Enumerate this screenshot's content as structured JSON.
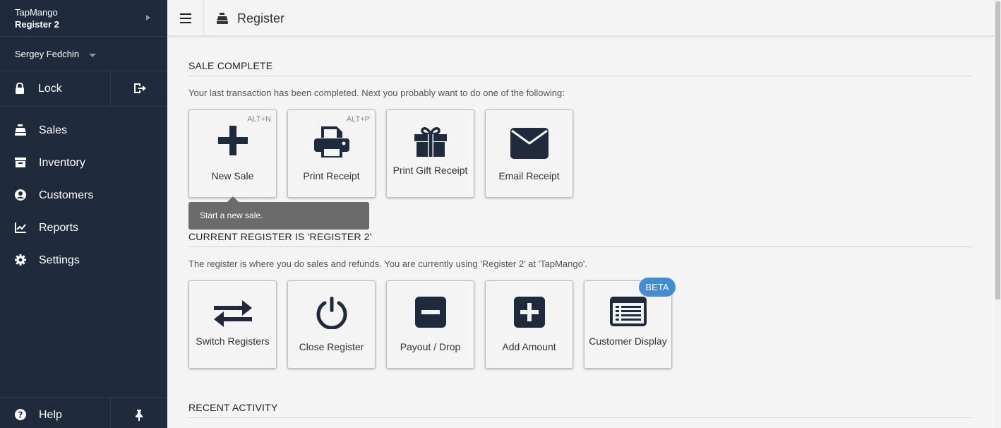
{
  "sidebar": {
    "store_name": "TapMango",
    "register_name": "Register 2",
    "user_name": "Sergey Fedchin",
    "lock_label": "Lock",
    "nav": [
      {
        "label": "Sales",
        "icon": "register-icon"
      },
      {
        "label": "Inventory",
        "icon": "inventory-icon"
      },
      {
        "label": "Customers",
        "icon": "user-circle-icon"
      },
      {
        "label": "Reports",
        "icon": "chart-line-icon"
      },
      {
        "label": "Settings",
        "icon": "gear-icon"
      }
    ],
    "help_label": "Help"
  },
  "topbar": {
    "title": "Register"
  },
  "sale_complete": {
    "title": "SALE COMPLETE",
    "description": "Your last transaction has been completed. Next you probably want to do one of the following:",
    "tiles": [
      {
        "label": "New Sale",
        "shortcut": "ALT+N",
        "icon": "plus-icon"
      },
      {
        "label": "Print Receipt",
        "shortcut": "ALT+P",
        "icon": "printer-icon"
      },
      {
        "label": "Print Gift Receipt",
        "icon": "gift-icon"
      },
      {
        "label": "Email Receipt",
        "icon": "envelope-icon"
      }
    ],
    "tooltip": "Start a new sale."
  },
  "current_register": {
    "title": "CURRENT REGISTER IS 'REGISTER 2'",
    "description": "The register is where you do sales and refunds. You are currently using 'Register 2'  at 'TapMango'.",
    "tiles": [
      {
        "label": "Switch Registers",
        "icon": "exchange-icon"
      },
      {
        "label": "Close Register",
        "icon": "power-icon"
      },
      {
        "label": "Payout / Drop",
        "icon": "minus-square-icon"
      },
      {
        "label": "Add Amount",
        "icon": "plus-square-icon"
      },
      {
        "label": "Customer Display",
        "icon": "list-display-icon",
        "badge": "BETA"
      }
    ]
  },
  "recent_activity": {
    "title": "RECENT ACTIVITY"
  },
  "colors": {
    "sidebar_bg": "#1f2a3c",
    "icon_dark": "#1f2a3c",
    "badge_blue": "#3f8dd3",
    "tooltip_bg": "#6b6b6b"
  }
}
